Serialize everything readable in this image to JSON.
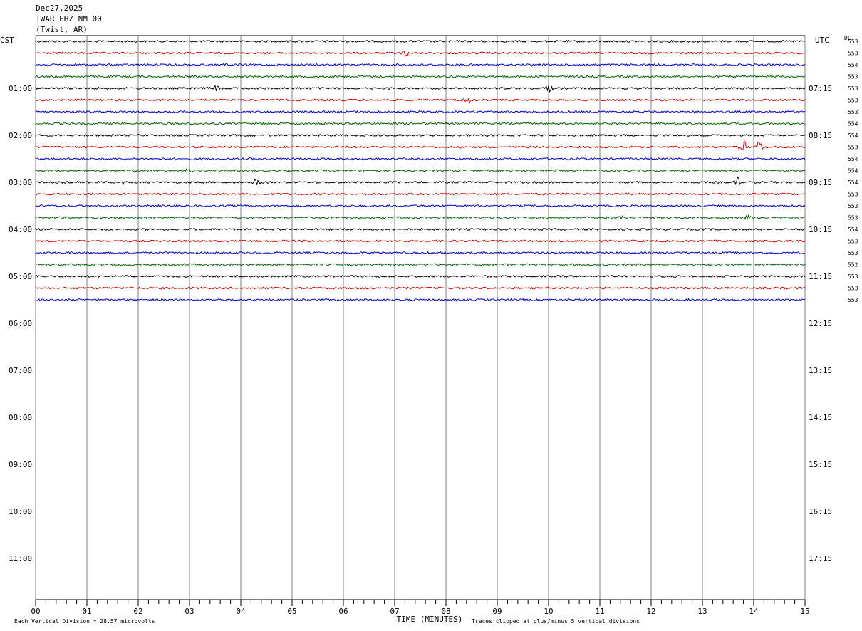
{
  "header": {
    "date": "Dec27,2025",
    "station": "TWAR EHZ NM 00",
    "location": "(Twist, AR)"
  },
  "chart_data": {
    "type": "line",
    "title": "Dec27,2025",
    "xlabel": "TIME (MINUTES)",
    "xlim": [
      0,
      15
    ],
    "x_tick_labels": [
      "00",
      "01",
      "02",
      "03",
      "04",
      "05",
      "06",
      "07",
      "08",
      "09",
      "10",
      "11",
      "12",
      "13",
      "14",
      "15"
    ],
    "left_axis_label": "CST",
    "right_axis_label": "UTC",
    "dc_label": "DC",
    "left_time_labels": [
      "01:00",
      "02:00",
      "03:00",
      "04:00",
      "05:00",
      "06:00",
      "07:00",
      "08:00",
      "09:00",
      "10:00",
      "11:00"
    ],
    "right_time_labels": [
      "07:15",
      "08:15",
      "09:15",
      "10:15",
      "11:15",
      "12:15",
      "13:15",
      "14:15",
      "15:15",
      "16:15",
      "17:15"
    ],
    "trace_colors": [
      "#000000",
      "#e00000",
      "#0000d0",
      "#006400"
    ],
    "traces_per_hour": 4,
    "trace_dc_offsets": [
      553,
      553,
      554,
      553,
      553,
      553,
      553,
      554,
      554,
      553,
      554,
      554,
      554,
      553,
      553,
      553,
      554,
      553,
      553,
      552,
      553,
      553,
      553
    ],
    "footer": {
      "left_note": "Each Vertical Division =   28.57 microvolts",
      "right_note": "Traces clipped at plus/minus 5 vertical divisions"
    }
  }
}
